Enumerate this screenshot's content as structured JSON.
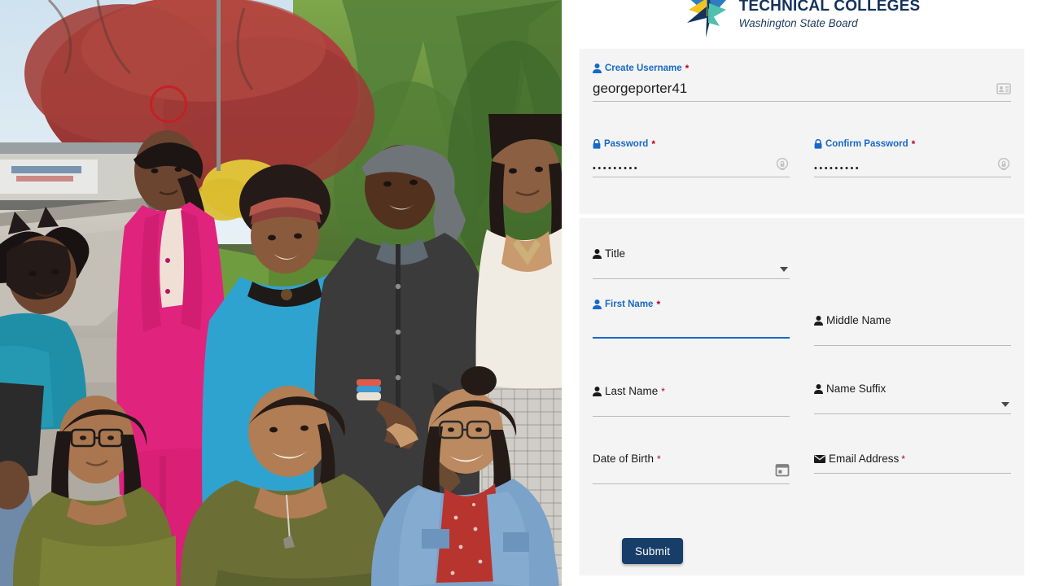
{
  "brand": {
    "logo_icon": "starburst-logo",
    "title": "TECHNICAL COLLEGES",
    "subtitle": "Washington State Board",
    "navy": "#14325c",
    "blue": "#1769c7",
    "teal": "#4fc0ad",
    "yellow": "#f2c420"
  },
  "photo": {
    "alt": "group-of-students-outdoors",
    "cursor_marker": "red-circle-highlight"
  },
  "account_card": {
    "username": {
      "icon": "person-icon",
      "label": "Create Username",
      "required_mark": "*",
      "value": "georgeporter41",
      "placeholder": "",
      "trailing_icon": "id-card-icon"
    },
    "password": {
      "icon": "lock-icon",
      "label": "Password",
      "required_mark": "*",
      "value": "•••••••••",
      "trailing_icon": "password-visibility-icon"
    },
    "confirm_password": {
      "icon": "lock-icon",
      "label": "Confirm Password",
      "required_mark": "*",
      "value": "•••••••••",
      "trailing_icon": "password-visibility-icon"
    }
  },
  "personal_card": {
    "title_field": {
      "icon": "person-icon",
      "label": "Title",
      "required_mark": "",
      "value": "",
      "trailing_icon": "chevron-down-icon"
    },
    "first_name": {
      "icon": "person-icon",
      "label": "First Name",
      "required_mark": "*",
      "value": "",
      "focused": true
    },
    "middle_name": {
      "icon": "person-icon",
      "label": "Middle Name",
      "required_mark": "",
      "value": ""
    },
    "last_name": {
      "icon": "person-icon",
      "label": "Last Name",
      "required_mark": "*",
      "value": ""
    },
    "name_suffix": {
      "icon": "person-icon",
      "label": "Name Suffix",
      "required_mark": "",
      "value": "",
      "trailing_icon": "chevron-down-icon"
    },
    "date_of_birth": {
      "icon": "",
      "label": "Date of Birth",
      "required_mark": "*",
      "value": "",
      "trailing_icon": "calendar-icon"
    },
    "email_address": {
      "icon": "envelope-icon",
      "label": "Email Address",
      "required_mark": "*",
      "value": ""
    },
    "submit_label": "Submit",
    "submit_color": "#173e68"
  }
}
